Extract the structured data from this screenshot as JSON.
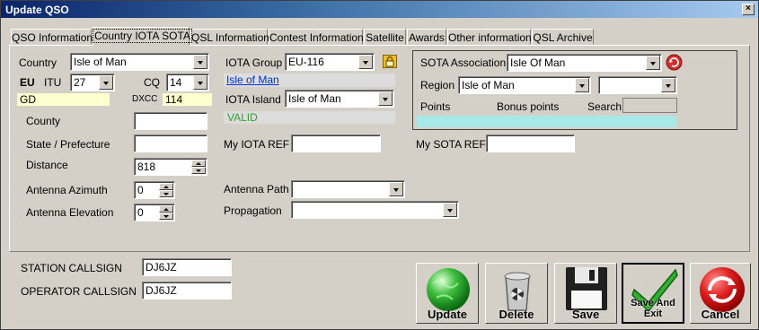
{
  "window": {
    "title": "Update QSO",
    "close_glyph": "×"
  },
  "tabs": [
    {
      "label": "QSO Information"
    },
    {
      "label": "Country IOTA SOTA"
    },
    {
      "label": "QSL Information"
    },
    {
      "label": "Contest Information"
    },
    {
      "label": "Satellite"
    },
    {
      "label": "Awards"
    },
    {
      "label": "Other information"
    },
    {
      "label": "QSL Archive"
    }
  ],
  "left": {
    "country_label": "Country",
    "country_value": "Isle of Man",
    "continent": "EU",
    "itu_label": "ITU",
    "itu_value": "27",
    "cq_label": "CQ",
    "cq_value": "14",
    "locator": "GD",
    "dxcc_label": "DXCC",
    "dxcc_value": "114",
    "county_label": "County",
    "county_value": "",
    "state_label": "State / Prefecture",
    "state_value": "",
    "distance_label": "Distance",
    "distance_value": "818",
    "azimuth_label": "Antenna Azimuth",
    "azimuth_value": "0",
    "elevation_label": "Antenna Elevation",
    "elevation_value": "0"
  },
  "iota": {
    "group_label": "IOTA Group",
    "group_value": "EU-116",
    "group_name": "Isle of Man",
    "island_label": "IOTA Island",
    "island_value": "Isle of Man",
    "status": "VALID",
    "my_ref_label": "My IOTA REF",
    "my_ref_value": "",
    "antenna_path_label": "Antenna Path",
    "antenna_path_value": "",
    "propagation_label": "Propagation",
    "propagation_value": ""
  },
  "sota": {
    "association_label": "SOTA Association",
    "association_value": "Isle Of Man",
    "region_label": "Region",
    "region_value": "Isle of Man",
    "region2_value": "",
    "points_label": "Points",
    "bonus_label": "Bonus points",
    "search_label": "Search",
    "search_value": "",
    "my_ref_label": "My SOTA REF",
    "my_ref_value": ""
  },
  "station": {
    "station_label": "STATION CALLSIGN",
    "station_value": "DJ6JZ",
    "operator_label": "OPERATOR CALLSIGN",
    "operator_value": "DJ6JZ"
  },
  "buttons": {
    "update": "Update",
    "delete": "Delete",
    "save": "Save",
    "save_exit": "Save And Exit",
    "cancel": "Cancel"
  }
}
